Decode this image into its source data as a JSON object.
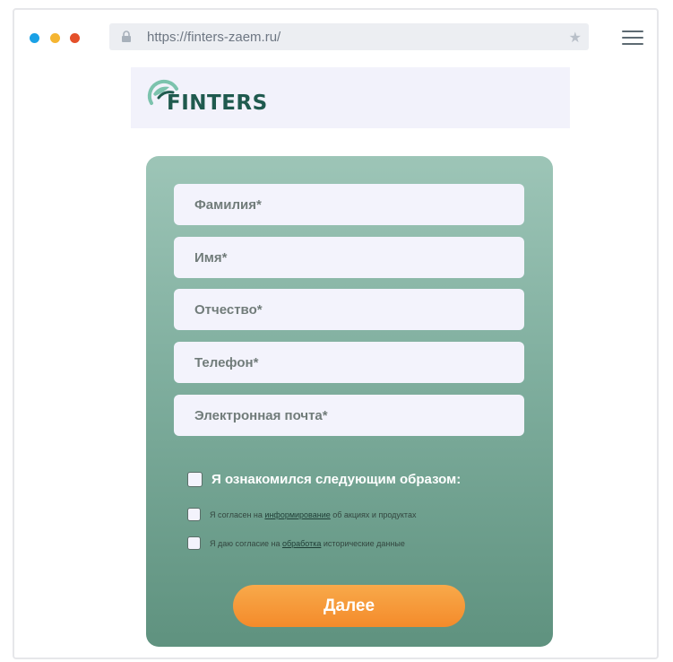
{
  "browser": {
    "url": "https://finters-zaem.ru/",
    "colors": {
      "dot_blue": "#1aa1e6",
      "dot_yellow": "#f5b531",
      "dot_red": "#e4502a"
    },
    "icons": [
      "lock-icon",
      "star-icon",
      "hamburger-menu-icon"
    ]
  },
  "brand": {
    "logo_text": "FINTERS",
    "color": "#1f5a4e"
  },
  "form": {
    "fields": [
      {
        "placeholder": "Фамилия*"
      },
      {
        "placeholder": "Имя*"
      },
      {
        "placeholder": "Отчество*"
      },
      {
        "placeholder": "Телефон*"
      },
      {
        "placeholder": "Электронная почта*"
      }
    ],
    "consent_main": "Я ознакомился следующим образом:",
    "consent_info": {
      "prefix": "Я согласен на",
      "link": "информирование",
      "suffix": "об акциях и продуктах"
    },
    "consent_data": {
      "prefix": "Я даю согласие на",
      "link": "обработка",
      "suffix": "исторические данные"
    },
    "submit_label": "Далее",
    "colors": {
      "card_top": "#9dc5b7",
      "card_bottom": "#5f927f",
      "button": "#f48b2b"
    }
  }
}
